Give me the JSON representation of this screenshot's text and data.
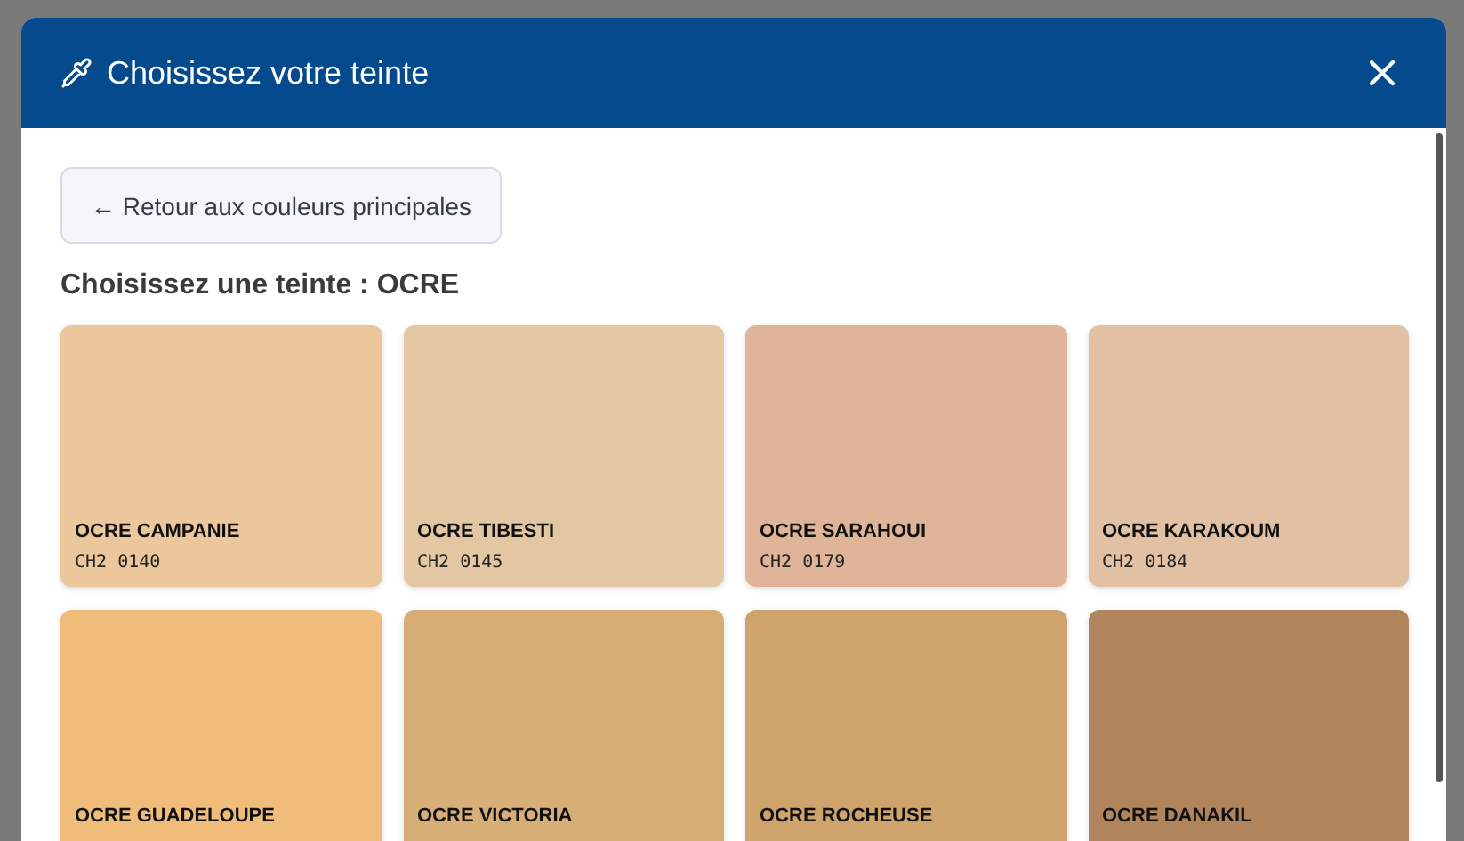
{
  "dialog": {
    "title": "Choisissez votre teinte",
    "back_button": "← Retour aux couleurs principales",
    "heading": "Choisissez une teinte : OCRE"
  },
  "swatches": [
    {
      "name": "OCRE CAMPANIE",
      "code": "CH2 0140",
      "color": "#ecc79c"
    },
    {
      "name": "OCRE TIBESTI",
      "code": "CH2 0145",
      "color": "#e3c6a2"
    },
    {
      "name": "OCRE SARAHOUI",
      "code": "CH2 0179",
      "color": "#e0b498"
    },
    {
      "name": "OCRE KARAKOUM",
      "code": "CH2 0184",
      "color": "#e1c0a3"
    },
    {
      "name": "OCRE GUADELOUPE",
      "color": "#efbc7a"
    },
    {
      "name": "OCRE VICTORIA",
      "color": "#d8ae77"
    },
    {
      "name": "OCRE ROCHEUSE",
      "color": "#cea36c"
    },
    {
      "name": "OCRE DANAKIL",
      "color": "#b0855b"
    }
  ]
}
